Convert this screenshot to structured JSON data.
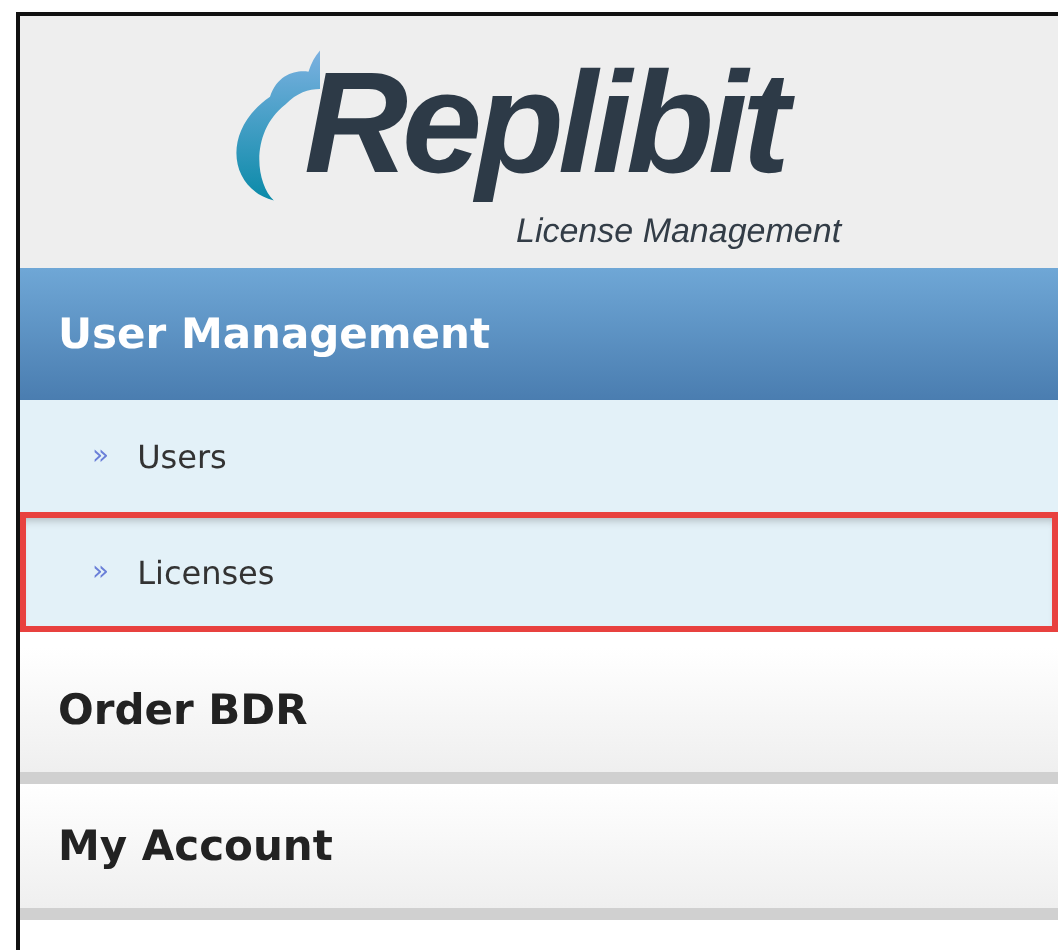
{
  "logo": {
    "name": "Replibit",
    "tagline": "License Management"
  },
  "menu": [
    {
      "label": "User Management",
      "expanded": true,
      "children": [
        {
          "label": "Users",
          "marker": "»",
          "highlighted": false
        },
        {
          "label": "Licenses",
          "marker": "»",
          "highlighted": true
        }
      ]
    },
    {
      "label": "Order BDR",
      "expanded": false
    },
    {
      "label": "My Account",
      "expanded": false
    }
  ]
}
